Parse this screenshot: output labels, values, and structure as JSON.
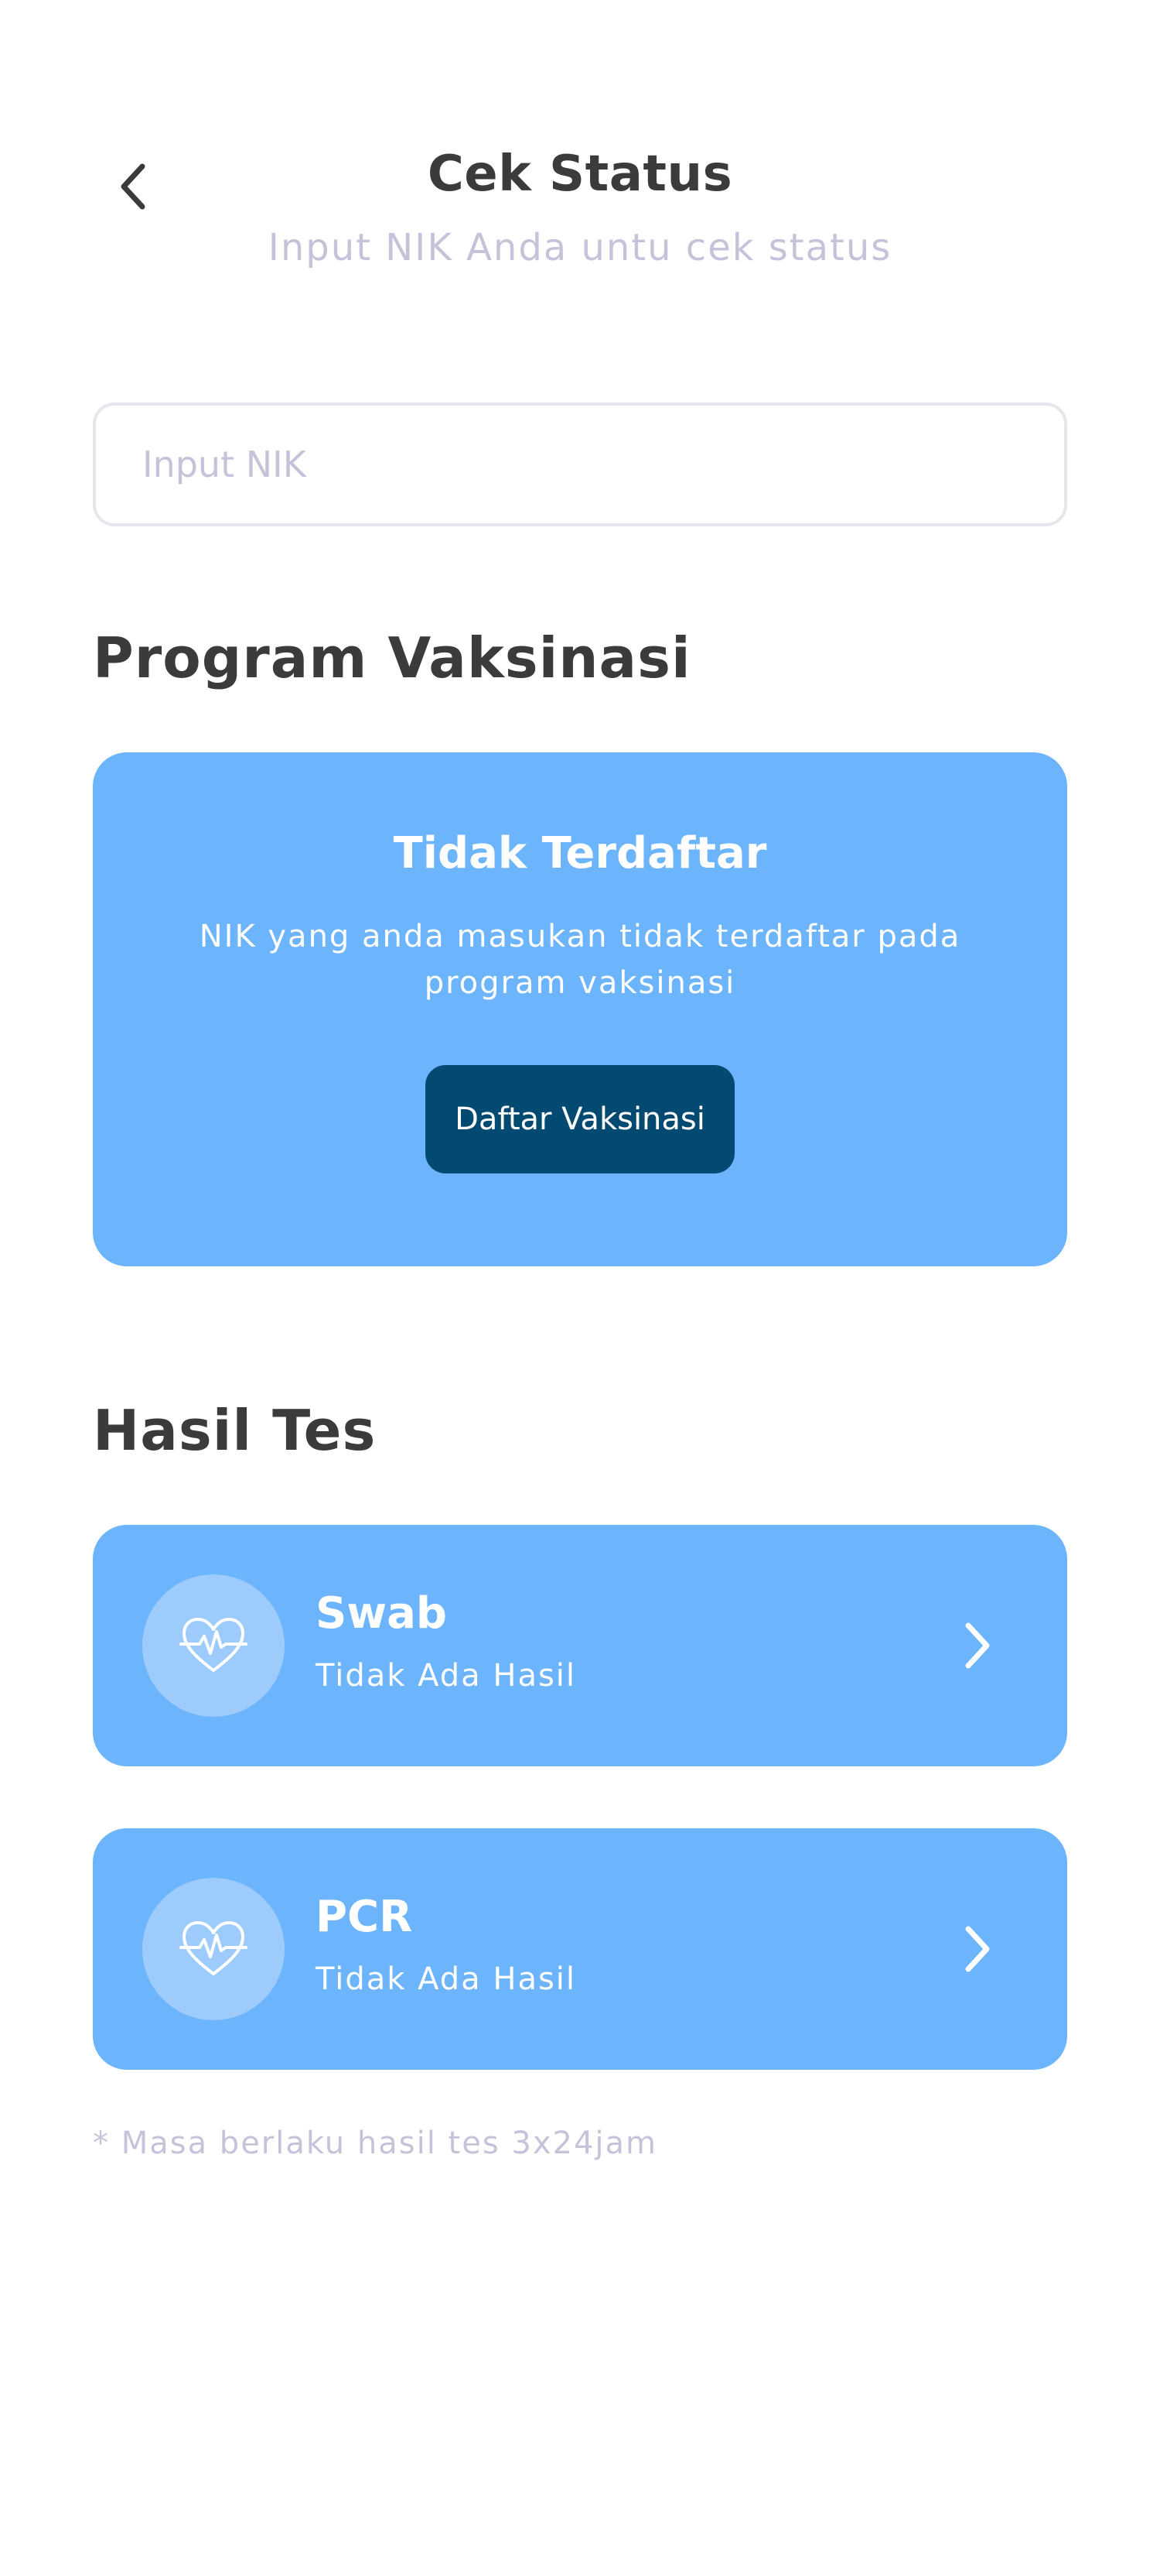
{
  "header": {
    "title": "Cek Status",
    "subtitle": "Input NIK Anda untu cek status",
    "back_icon": "chevron-left-icon"
  },
  "nik_input": {
    "placeholder": "Input NIK",
    "value": ""
  },
  "vaccination": {
    "heading": "Program Vaksinasi",
    "status_title": "Tidak Terdaftar",
    "status_description": "NIK yang anda masukan tidak terdaftar pada program vaksinasi",
    "register_button_label": "Daftar Vaksinasi"
  },
  "test_results": {
    "heading": "Hasil Tes",
    "items": [
      {
        "name": "Swab",
        "result": "Tidak Ada Hasil",
        "icon": "heart-pulse-icon"
      },
      {
        "name": "PCR",
        "result": "Tidak Ada Hasil",
        "icon": "heart-pulse-icon"
      }
    ],
    "footnote": "* Masa berlaku hasil tes 3x24jam"
  },
  "colors": {
    "card_blue": "#6cb4fb",
    "button_dark_blue": "#024a72",
    "muted_text": "#c5c3d9",
    "heading_text": "#3b3b3b"
  }
}
